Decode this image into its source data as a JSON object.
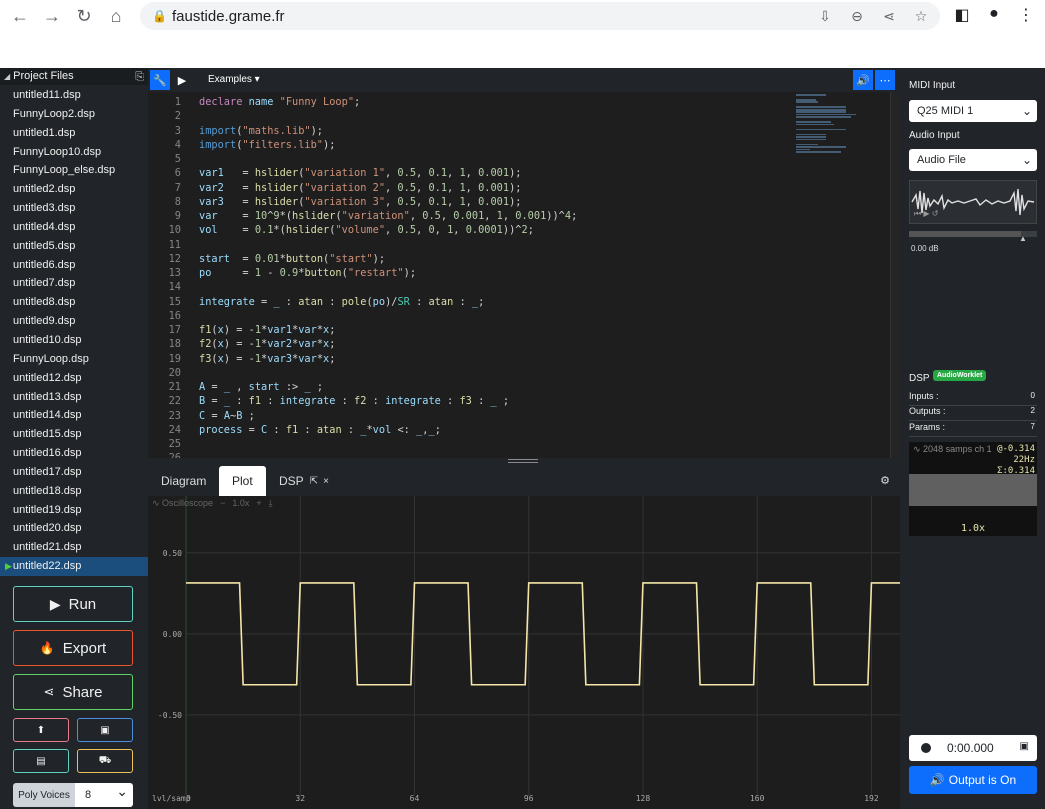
{
  "browser": {
    "url": "faustide.grame.fr"
  },
  "project_files": {
    "header": "Project Files",
    "files": [
      "untitled11.dsp",
      "FunnyLoop2.dsp",
      "untitled1.dsp",
      "FunnyLoop10.dsp",
      "FunnyLoop_else.dsp",
      "untitled2.dsp",
      "untitled3.dsp",
      "untitled4.dsp",
      "untitled5.dsp",
      "untitled6.dsp",
      "untitled7.dsp",
      "untitled8.dsp",
      "untitled9.dsp",
      "untitled10.dsp",
      "FunnyLoop.dsp",
      "untitled12.dsp",
      "untitled13.dsp",
      "untitled14.dsp",
      "untitled15.dsp",
      "untitled16.dsp",
      "untitled17.dsp",
      "untitled18.dsp",
      "untitled19.dsp",
      "untitled20.dsp",
      "untitled21.dsp",
      "untitled22.dsp"
    ],
    "active_index": 25
  },
  "actions": {
    "run": "Run",
    "export": "Export",
    "share": "Share",
    "poly_label": "Poly Voices",
    "poly_value": "8"
  },
  "toolbar": {
    "examples": "Examples"
  },
  "code": {
    "line_numbers": [
      "1",
      "2",
      "3",
      "4",
      "5",
      "6",
      "7",
      "8",
      "9",
      "10",
      "11",
      "12",
      "13",
      "14",
      "15",
      "16",
      "17",
      "18",
      "19",
      "20",
      "21",
      "22",
      "23",
      "24",
      "25",
      "26"
    ]
  },
  "tabs": {
    "diagram": "Diagram",
    "plot": "Plot",
    "dsp": "DSP"
  },
  "scope_toolbar": {
    "name": "Oscilloscope",
    "zoom": "1.0x"
  },
  "chart_data": {
    "type": "line",
    "x_label": "lvl/samp",
    "x_ticks": [
      "0",
      "32",
      "64",
      "96",
      "128",
      "160",
      "192"
    ],
    "y_ticks": [
      "0.50",
      "0.00",
      "-0.50"
    ],
    "ylim": [
      -1.0,
      0.85
    ],
    "xlim": [
      0,
      200
    ],
    "high": 0.314,
    "low": -0.314,
    "transitions": [
      15,
      16,
      31,
      32,
      47,
      48,
      63,
      64,
      79,
      80,
      95,
      96,
      111,
      112,
      127,
      128,
      143,
      144,
      159,
      160,
      175,
      176,
      191,
      192
    ],
    "color": "#f5e6a8"
  },
  "right": {
    "midi_label": "MIDI Input",
    "midi_value": "Q25 MIDI 1",
    "audio_label": "Audio Input",
    "audio_value": "Audio File",
    "gain": "0.00 dB",
    "dsp_label": "DSP",
    "dsp_badge": "AudioWorklet",
    "inputs_label": "Inputs :",
    "inputs_value": "0",
    "outputs_label": "Outputs :",
    "outputs_value": "2",
    "params_label": "Params :",
    "params_value": "7",
    "scope_info": "2048 samps  ch 1",
    "scope_val1": "@-0.314",
    "scope_val2": "22Hz",
    "scope_val3": "Σ:0.314",
    "scope_zoom": "1.0x",
    "rec_time": "0:00.000",
    "output_btn": "Output is On"
  },
  "colors": {
    "accent": "#0d6efd",
    "run_border": "#5fd3c0",
    "export_border": "#e8572a",
    "share_border": "#5fd36a"
  }
}
